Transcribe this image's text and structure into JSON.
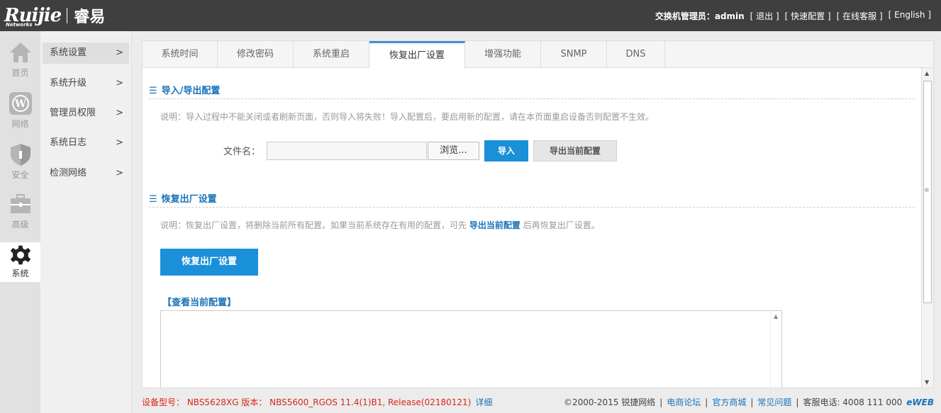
{
  "header": {
    "brand": "Ruijie",
    "brand_sub": "Networks",
    "product": "睿易",
    "admin_label": "交换机管理员：admin",
    "links": [
      "[ 退出 ]",
      "[ 快速配置 ]",
      "[ 在线客服 ]",
      "[ English ]"
    ]
  },
  "icon_nav": [
    {
      "label": "首页",
      "icon": "home-icon"
    },
    {
      "label": "网络",
      "icon": "wordpress-icon"
    },
    {
      "label": "安全",
      "icon": "shield-icon"
    },
    {
      "label": "高级",
      "icon": "toolbox-icon"
    },
    {
      "label": "系统",
      "icon": "gear-icon",
      "active": true
    }
  ],
  "sub_nav": [
    {
      "label": "系统设置",
      "arrow": ">",
      "active": true
    },
    {
      "label": "系统升级",
      "arrow": ">"
    },
    {
      "label": "管理员权限",
      "arrow": ">"
    },
    {
      "label": "系统日志",
      "arrow": ">"
    },
    {
      "label": "检测网络",
      "arrow": ">"
    }
  ],
  "tabs": [
    "系统时间",
    "修改密码",
    "系统重启",
    "恢复出厂设置",
    "增强功能",
    "SNMP",
    "DNS"
  ],
  "active_tab": "恢复出厂设置",
  "import_section": {
    "bar": "☰",
    "title": "导入/导出配置",
    "note": "说明：导入过程中不能关闭或者刷新页面，否则导入将失败！导入配置后，要启用新的配置，请在本页面重启设备否则配置不生效。",
    "file_label": "文件名：",
    "file_value": "",
    "browse_label": "浏览...",
    "import_label": "导入",
    "export_label": "导出当前配置"
  },
  "restore_section": {
    "bar": "☰",
    "title": "恢复出厂设置",
    "note_prefix": "说明：恢复出厂设置，将删除当前所有配置。如果当前系统存在有用的配置，可先",
    "note_link": "导出当前配置",
    "note_suffix": "后再恢复出厂设置。",
    "restore_label": "恢复出厂设置",
    "view_config_label": "【查看当前配置】",
    "config_text": ""
  },
  "footer": {
    "model": "设备型号：  NBS5628XG   版本：  NBS5600_RGOS 11.4(1)B1, Release(02180121)",
    "detail": "详细",
    "copyright": "©2000-2015 锐捷网络",
    "links": [
      "电商论坛",
      "官方商城",
      "常见问题"
    ],
    "hotline": "客服电话: 4008 111 000",
    "eweb": "eWEB"
  },
  "colors": {
    "accent": "#1a90d8",
    "header_bg": "#3f3f3f",
    "link": "#1a73b8",
    "footer_red": "#d9261c"
  }
}
